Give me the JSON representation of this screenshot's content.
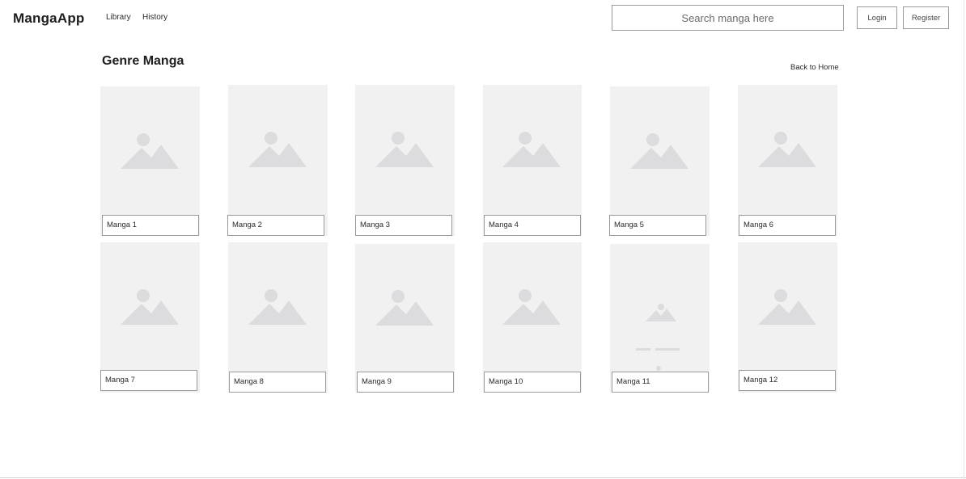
{
  "header": {
    "logo": "MangaApp",
    "nav": [
      {
        "label": "Library"
      },
      {
        "label": "History"
      }
    ],
    "search": {
      "placeholder": "Search manga here",
      "value": ""
    },
    "login_label": "Login",
    "register_label": "Register"
  },
  "main": {
    "title": "Genre Manga",
    "back_label": "Back to Home",
    "cards": [
      {
        "title": "Manga 1",
        "icon": "image-placeholder-icon"
      },
      {
        "title": "Manga 2",
        "icon": "image-placeholder-icon"
      },
      {
        "title": "Manga 3",
        "icon": "image-placeholder-icon"
      },
      {
        "title": "Manga 4",
        "icon": "image-placeholder-icon"
      },
      {
        "title": "Manga 5",
        "icon": "image-placeholder-icon"
      },
      {
        "title": "Manga 6",
        "icon": "image-placeholder-icon"
      },
      {
        "title": "Manga 7",
        "icon": "image-placeholder-icon"
      },
      {
        "title": "Manga 8",
        "icon": "image-placeholder-icon"
      },
      {
        "title": "Manga 9",
        "icon": "image-placeholder-icon"
      },
      {
        "title": "Manga 10",
        "icon": "image-placeholder-icon"
      },
      {
        "title": "Manga 11",
        "icon": "content-placeholder-icon"
      },
      {
        "title": "Manga 12",
        "icon": "image-placeholder-icon"
      }
    ]
  },
  "colors": {
    "placeholder_bg": "#f1f1f2",
    "placeholder_icon": "#dcdcde",
    "border": "#9a9a9a",
    "text": "#1e1e1e"
  }
}
